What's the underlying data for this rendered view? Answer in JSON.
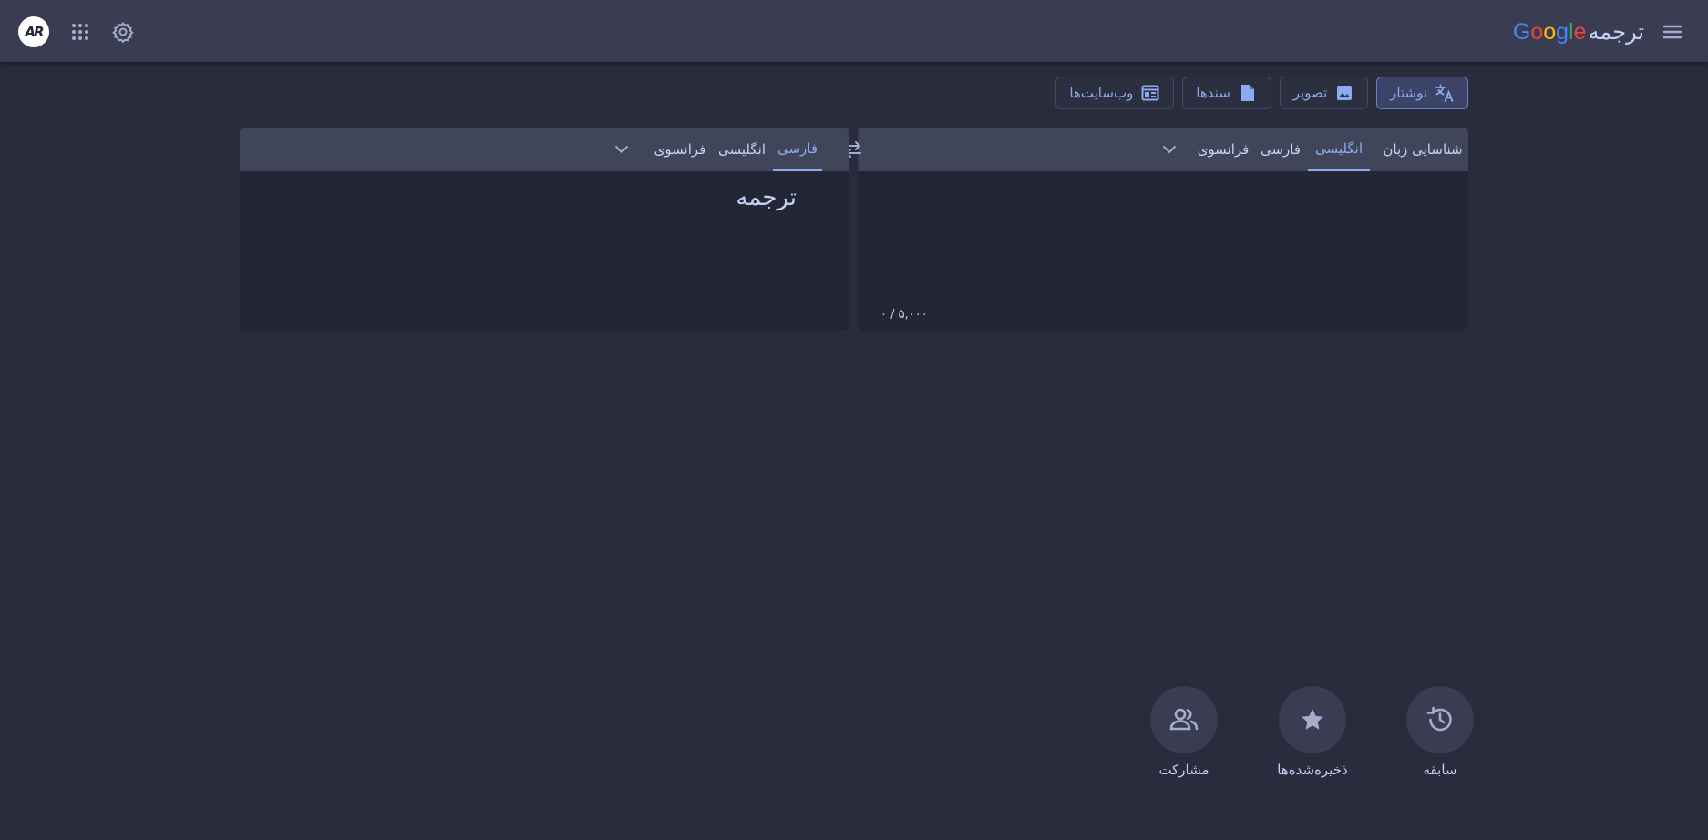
{
  "header": {
    "avatar_initials": "AR",
    "logo_text": "Google",
    "app_title": "ترجمه",
    "icons": [
      "menu-icon",
      "apps-grid-icon",
      "gear-icon"
    ]
  },
  "modes": [
    {
      "label": "نوشتار",
      "icon": "translate-icon",
      "active": true
    },
    {
      "label": "تصویر",
      "icon": "image-icon",
      "active": false
    },
    {
      "label": "سندها",
      "icon": "document-icon",
      "active": false
    },
    {
      "label": "وب‌سایت‌ها",
      "icon": "website-icon",
      "active": false
    }
  ],
  "source_langs": {
    "detect": "شناسایی زبان",
    "tabs": [
      "انگلیسی",
      "فارسی",
      "فرانسوی"
    ],
    "selected": "انگلیسی"
  },
  "target_langs": {
    "tabs": [
      "فارسی",
      "انگلیسی",
      "فرانسوی"
    ],
    "selected": "فارسی"
  },
  "source_panel": {
    "char_counter": "۰ / ۵,۰۰۰"
  },
  "target_panel": {
    "placeholder": "ترجمه"
  },
  "bottom_actions": [
    {
      "label": "سابقه",
      "icon": "history-icon"
    },
    {
      "label": "ذخیره‌شده‌ها",
      "icon": "star-icon"
    },
    {
      "label": "مشارکت",
      "icon": "people-icon"
    }
  ],
  "colors": {
    "accent": "#8caaee",
    "background": "#292c3c",
    "panel": "#232634",
    "bar": "#414559"
  }
}
